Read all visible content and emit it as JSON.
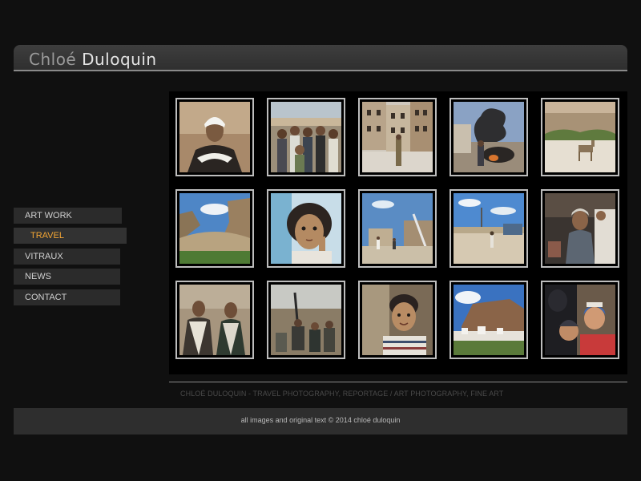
{
  "header": {
    "title_first": "Chloé",
    "title_last": "Duloquin"
  },
  "nav": {
    "items": [
      {
        "label": "ART WORK",
        "active": false
      },
      {
        "label": "TRAVEL",
        "active": true
      },
      {
        "label": "VITRAUX",
        "active": false
      },
      {
        "label": "NEWS",
        "active": false
      },
      {
        "label": "CONTACT",
        "active": false
      }
    ],
    "active_color": "#f2a534"
  },
  "gallery": {
    "thumbnails": [
      {
        "icon": "portrait-man-white-turban-photo"
      },
      {
        "icon": "crowd-of-people-photo"
      },
      {
        "icon": "old-tower-houses-photo"
      },
      {
        "icon": "smoke-and-fire-photo"
      },
      {
        "icon": "donkey-in-village-photo"
      },
      {
        "icon": "canyon-cliffs-photo"
      },
      {
        "icon": "portrait-girl-photo"
      },
      {
        "icon": "street-with-people-photo"
      },
      {
        "icon": "desert-road-with-car-photo"
      },
      {
        "icon": "boy-in-market-photo"
      },
      {
        "icon": "two-men-portrait-photo"
      },
      {
        "icon": "group-with-rifle-photo"
      },
      {
        "icon": "portrait-boy-striped-sweater-photo"
      },
      {
        "icon": "cliff-village-photo"
      },
      {
        "icon": "veiled-woman-with-children-photo"
      }
    ]
  },
  "footer": {
    "tagline": "CHLOÉ DULOQUIN - TRAVEL PHOTOGRAPHY, REPORTAGE / ART PHOTOGRAPHY, FINE ART",
    "copyright": "all images and original text © 2014 chloé duloquin"
  }
}
